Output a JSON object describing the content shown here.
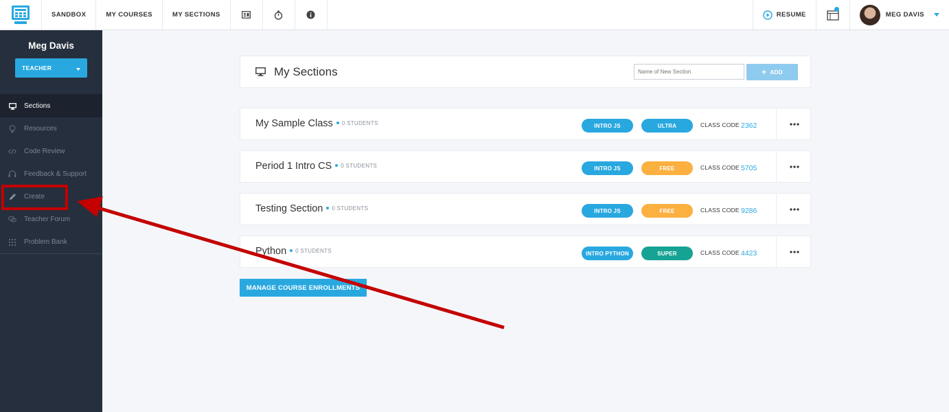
{
  "topbar": {
    "nav": [
      "SANDBOX",
      "MY COURSES",
      "MY SECTIONS"
    ],
    "resume_label": "RESUME",
    "user_name": "MEG DAVIS"
  },
  "sidebar": {
    "name": "Meg Davis",
    "role": "TEACHER",
    "items": [
      {
        "label": "Sections",
        "icon": "monitor-icon"
      },
      {
        "label": "Resources",
        "icon": "lightbulb-icon"
      },
      {
        "label": "Code Review",
        "icon": "code-icon"
      },
      {
        "label": "Feedback & Support",
        "icon": "headset-icon"
      },
      {
        "label": "Create",
        "icon": "pencil-icon"
      },
      {
        "label": "Teacher Forum",
        "icon": "chat-icon"
      },
      {
        "label": "Problem Bank",
        "icon": "grid-icon"
      }
    ]
  },
  "main": {
    "title": "My Sections",
    "new_section_placeholder": "Name of New Section",
    "add_label": "ADD",
    "class_code_label": "CLASS CODE",
    "sections": [
      {
        "name": "My Sample Class",
        "students": "0 STUDENTS",
        "course": "INTRO JS",
        "tier": "ULTRA",
        "tier_color": "#29a8e0",
        "code": "2362"
      },
      {
        "name": "Period 1 Intro CS",
        "students": "0 STUDENTS",
        "course": "INTRO JS",
        "tier": "FREE",
        "tier_color": "#fbb040",
        "code": "5705"
      },
      {
        "name": "Testing Section",
        "students": "0 STUDENTS",
        "course": "INTRO JS",
        "tier": "FREE",
        "tier_color": "#fbb040",
        "code": "9286"
      },
      {
        "name": "Python",
        "students": "0 STUDENTS",
        "course": "INTRO PYTHON",
        "tier": "SUPER",
        "tier_color": "#17a394",
        "code": "4423"
      }
    ],
    "manage_label": "MANAGE COURSE ENROLLMENTS"
  },
  "colors": {
    "accent": "#29a8e0",
    "sidebar_bg": "#262f3d",
    "annotation_red": "#c40000"
  }
}
